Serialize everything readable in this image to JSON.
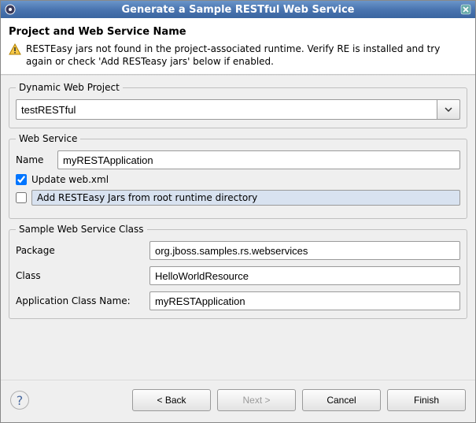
{
  "window": {
    "title": "Generate a Sample RESTful Web Service"
  },
  "header": {
    "title": "Project and Web Service Name",
    "warning": "RESTEasy jars not found in the project-associated runtime. Verify RE is installed and try again or check 'Add RESTeasy jars' below if enabled."
  },
  "project": {
    "legend": "Dynamic Web Project",
    "value": "testRESTful"
  },
  "webservice": {
    "legend": "Web Service",
    "name_label": "Name",
    "name_value": "myRESTApplication",
    "update_web_xml_label": "Update web.xml",
    "update_web_xml_checked": true,
    "add_jars_label": "Add RESTEasy Jars from root runtime directory",
    "add_jars_checked": false
  },
  "sample": {
    "legend": "Sample Web Service Class",
    "package_label": "Package",
    "package_value": "org.jboss.samples.rs.webservices",
    "class_label": "Class",
    "class_value": "HelloWorldResource",
    "appclass_label": "Application Class Name:",
    "appclass_value": "myRESTApplication"
  },
  "buttons": {
    "back": "< Back",
    "next": "Next >",
    "cancel": "Cancel",
    "finish": "Finish",
    "help": "?"
  }
}
